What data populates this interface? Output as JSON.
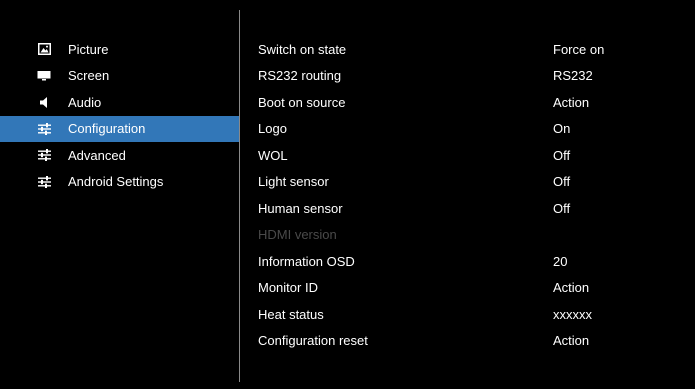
{
  "colors": {
    "background": "#000000",
    "selected_highlight": "#3277b8",
    "text": "#ffffff",
    "disabled_text": "#4a4a4a",
    "divider": "#8a8a8a"
  },
  "menu": {
    "items": [
      {
        "label": "Picture",
        "icon": "picture-icon",
        "selected": false
      },
      {
        "label": "Screen",
        "icon": "screen-icon",
        "selected": false
      },
      {
        "label": "Audio",
        "icon": "speaker-icon",
        "selected": false
      },
      {
        "label": "Configuration",
        "icon": "sliders-icon",
        "selected": true
      },
      {
        "label": "Advanced",
        "icon": "sliders-icon",
        "selected": false
      },
      {
        "label": "Android Settings",
        "icon": "sliders-icon",
        "selected": false
      }
    ]
  },
  "settings": {
    "rows": [
      {
        "label": "Switch on state",
        "value": "Force on",
        "disabled": false
      },
      {
        "label": "RS232 routing",
        "value": "RS232",
        "disabled": false
      },
      {
        "label": "Boot on source",
        "value": "Action",
        "disabled": false
      },
      {
        "label": "Logo",
        "value": "On",
        "disabled": false
      },
      {
        "label": "WOL",
        "value": "Off",
        "disabled": false
      },
      {
        "label": "Light sensor",
        "value": "Off",
        "disabled": false
      },
      {
        "label": "Human sensor",
        "value": "Off",
        "disabled": false
      },
      {
        "label": "HDMI version",
        "value": "",
        "disabled": true
      },
      {
        "label": "Information OSD",
        "value": "20",
        "disabled": false
      },
      {
        "label": "Monitor ID",
        "value": "Action",
        "disabled": false
      },
      {
        "label": "Heat status",
        "value": "xxxxxx",
        "disabled": false
      },
      {
        "label": "Configuration reset",
        "value": "Action",
        "disabled": false
      }
    ]
  }
}
